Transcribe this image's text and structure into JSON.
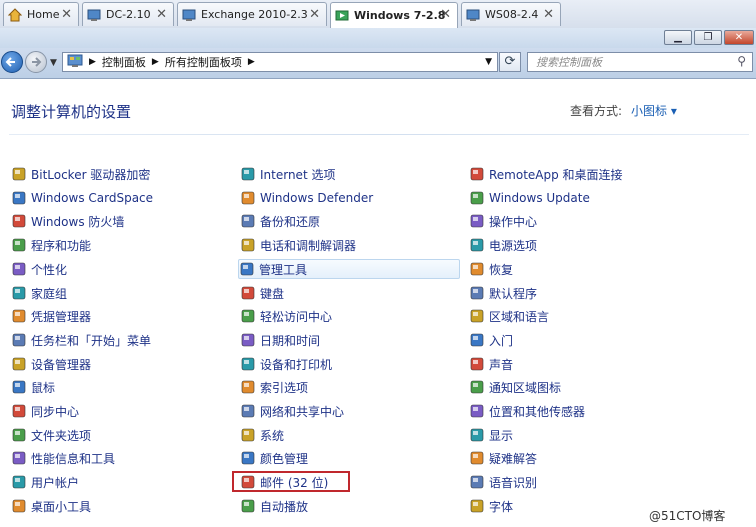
{
  "tabs": [
    {
      "label": "Home",
      "icon": "home-icon",
      "active": false
    },
    {
      "label": "DC-2.10",
      "icon": "vm-icon",
      "active": false
    },
    {
      "label": "Exchange 2010-2.3",
      "icon": "vm-icon",
      "active": false
    },
    {
      "label": "Windows 7-2.8",
      "icon": "vm-icon",
      "active": true
    },
    {
      "label": "WS08-2.4",
      "icon": "vm-icon",
      "active": false
    }
  ],
  "address": {
    "breadcrumb": [
      "控制面板",
      "所有控制面板项"
    ],
    "search_placeholder": "搜索控制面板"
  },
  "content": {
    "heading": "调整计算机的设置",
    "view_by_label": "查看方式:",
    "view_by_value": "小图标 ▾"
  },
  "columns": [
    [
      "BitLocker 驱动器加密",
      "Windows CardSpace",
      "Windows 防火墙",
      "程序和功能",
      "个性化",
      "家庭组",
      "凭据管理器",
      "任务栏和「开始」菜单",
      "设备管理器",
      "鼠标",
      "同步中心",
      "文件夹选项",
      "性能信息和工具",
      "用户帐户",
      "桌面小工具"
    ],
    [
      "Internet 选项",
      "Windows Defender",
      "备份和还原",
      "电话和调制解调器",
      "管理工具",
      "键盘",
      "轻松访问中心",
      "日期和时间",
      "设备和打印机",
      "索引选项",
      "网络和共享中心",
      "系统",
      "颜色管理",
      "邮件 (32 位)",
      "自动播放"
    ],
    [
      "RemoteApp 和桌面连接",
      "Windows Update",
      "操作中心",
      "电源选项",
      "恢复",
      "默认程序",
      "区域和语言",
      "入门",
      "声音",
      "通知区域图标",
      "位置和其他传感器",
      "显示",
      "疑难解答",
      "语音识别",
      "字体"
    ]
  ],
  "hovered_item": "管理工具",
  "highlighted_item": "邮件 (32 位)",
  "watermark": "@51CTO博客"
}
